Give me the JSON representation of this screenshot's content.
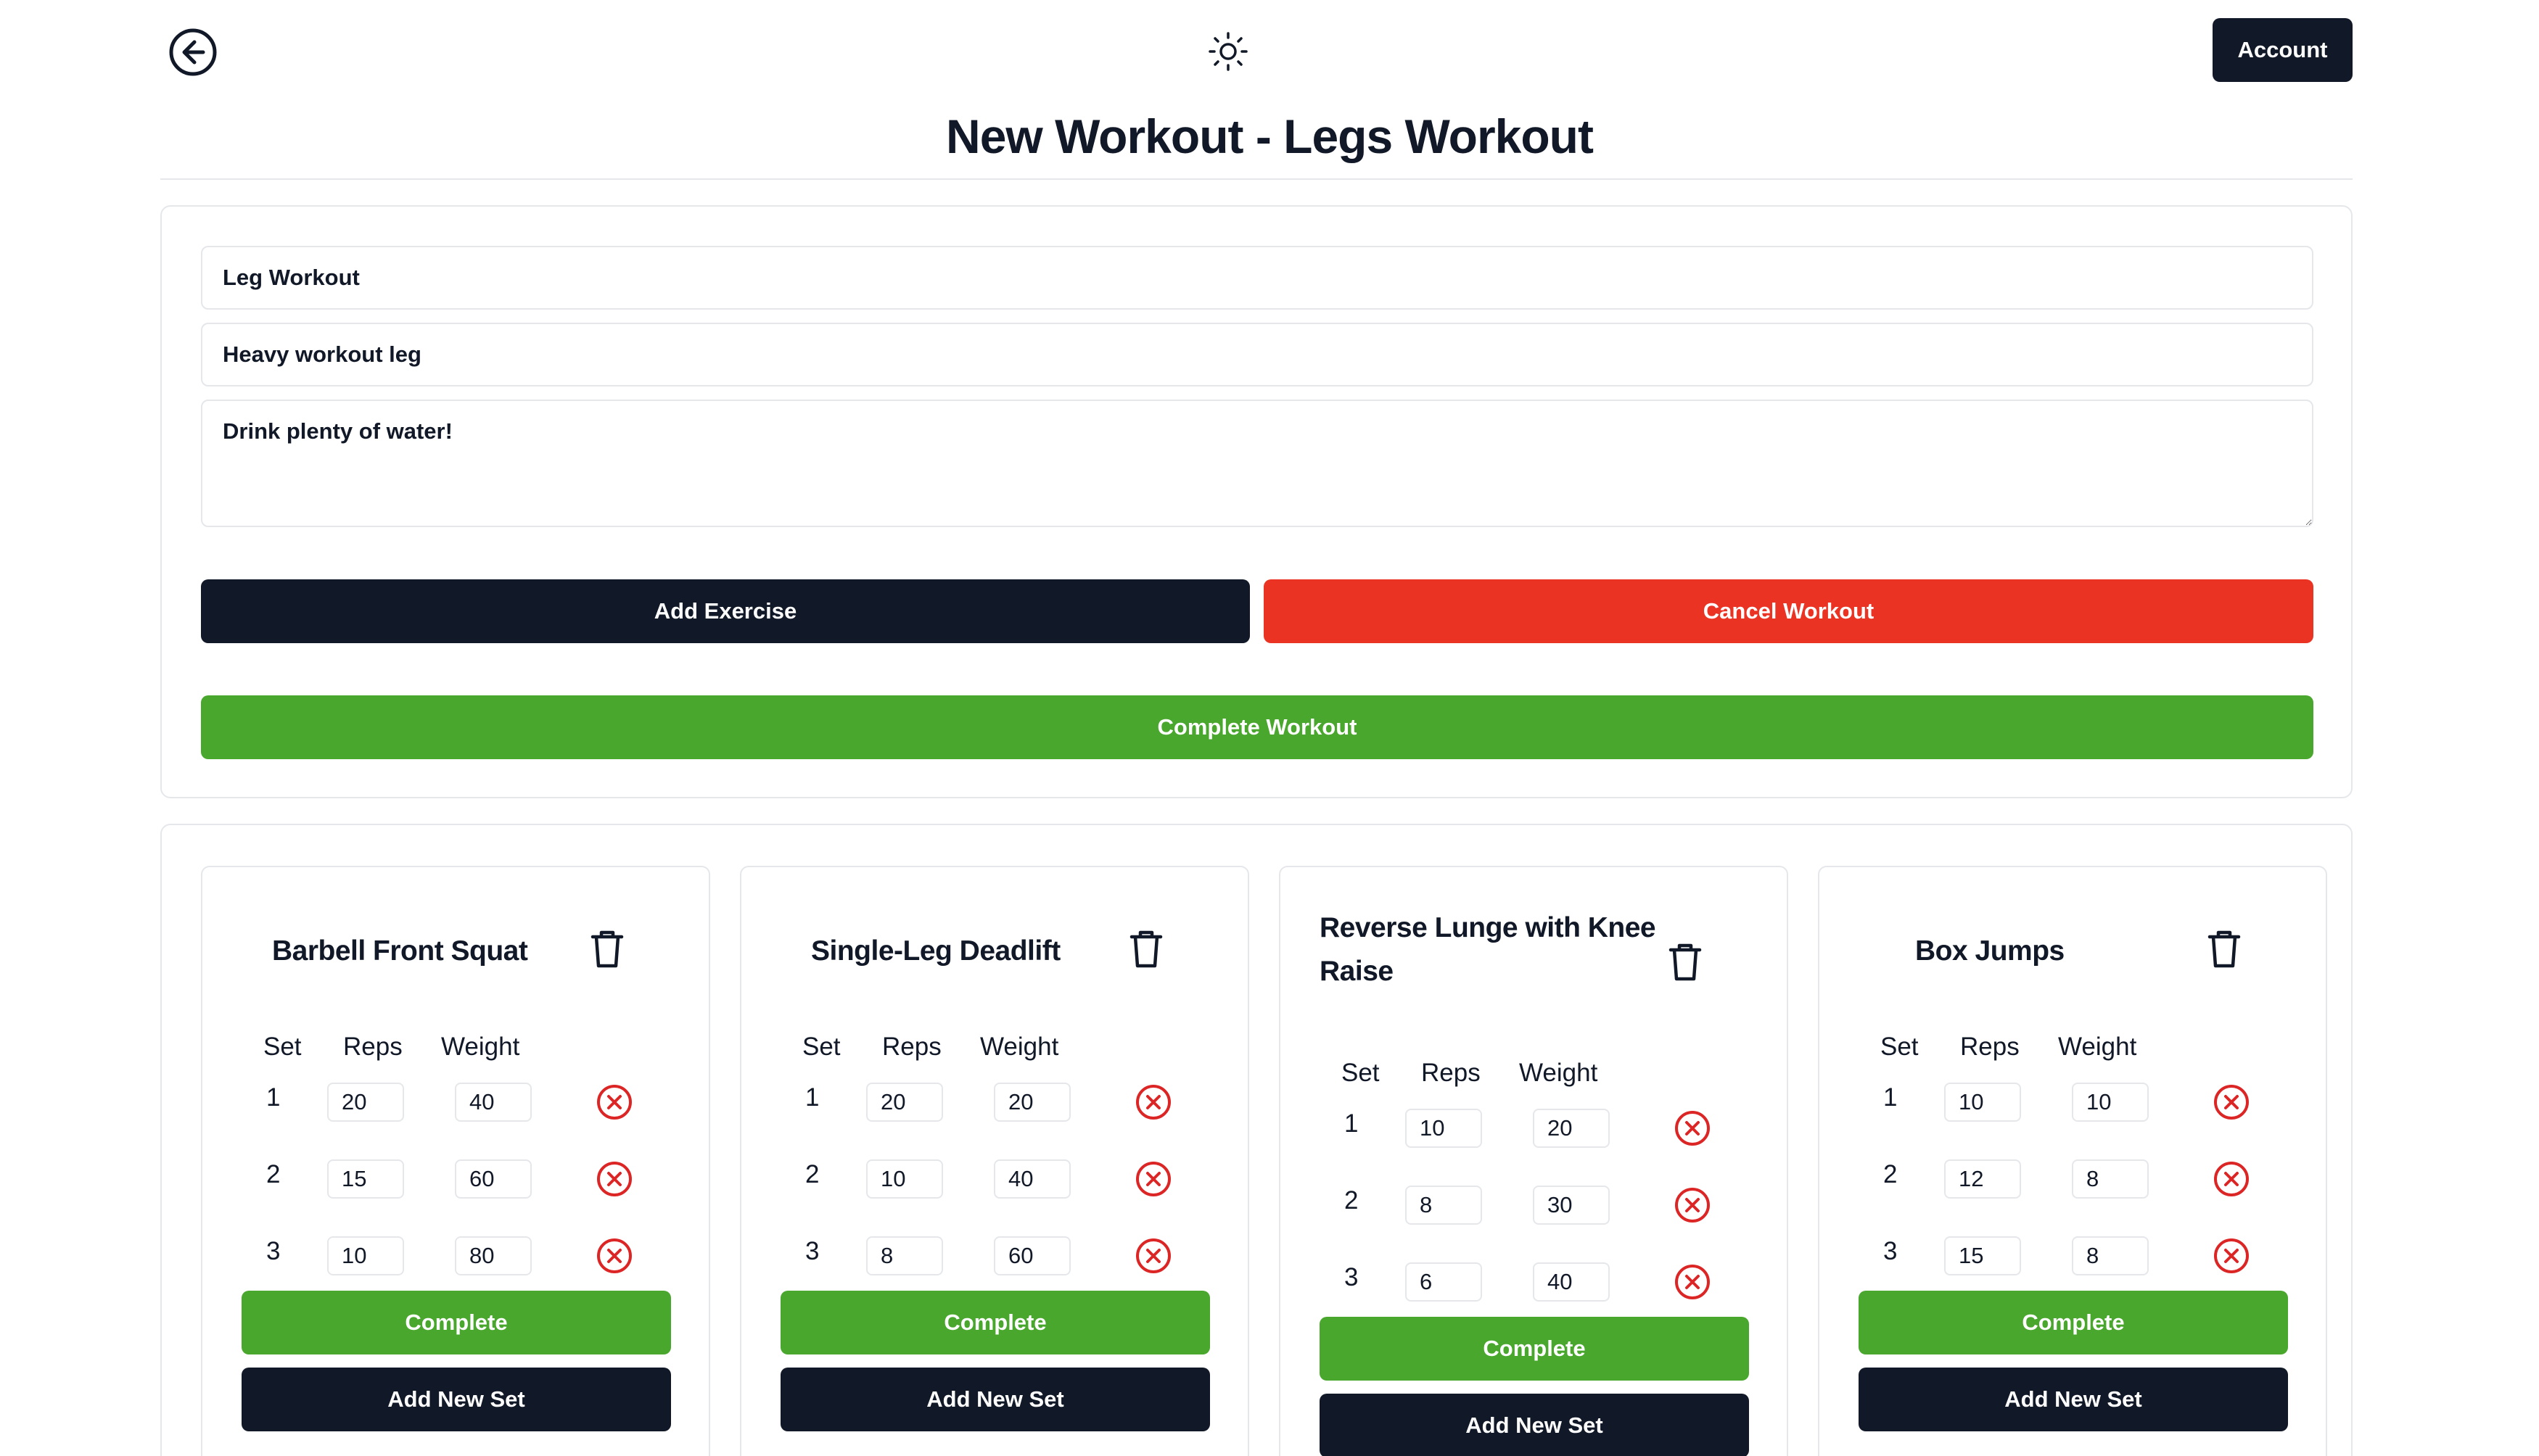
{
  "header": {
    "back_icon": "arrow-left-circle-icon",
    "theme_icon": "sun-icon",
    "account_label": "Account",
    "title": "New Workout - Legs Workout"
  },
  "form": {
    "name_value": "Leg Workout",
    "description_value": "Heavy workout leg",
    "notes_value": "Drink plenty of water!",
    "add_exercise_label": "Add Exercise",
    "cancel_workout_label": "Cancel Workout",
    "complete_workout_label": "Complete Workout"
  },
  "colors": {
    "primary": "#111827",
    "danger": "#ea3323",
    "success": "#4aa72d",
    "remove_icon": "#dc2626"
  },
  "exercises": [
    {
      "name": "Barbell Front Squat",
      "columns": {
        "set": "Set",
        "reps": "Reps",
        "weight": "Weight"
      },
      "sets": [
        {
          "set": "1",
          "reps": "20",
          "weight": "40"
        },
        {
          "set": "2",
          "reps": "15",
          "weight": "60"
        },
        {
          "set": "3",
          "reps": "10",
          "weight": "80"
        }
      ],
      "complete_label": "Complete",
      "add_set_label": "Add New Set"
    },
    {
      "name": "Single-Leg Deadlift",
      "columns": {
        "set": "Set",
        "reps": "Reps",
        "weight": "Weight"
      },
      "sets": [
        {
          "set": "1",
          "reps": "20",
          "weight": "20"
        },
        {
          "set": "2",
          "reps": "10",
          "weight": "40"
        },
        {
          "set": "3",
          "reps": "8",
          "weight": "60"
        }
      ],
      "complete_label": "Complete",
      "add_set_label": "Add New Set"
    },
    {
      "name_line1": "Reverse Lunge with Knee",
      "name_line2": "Raise",
      "columns": {
        "set": "Set",
        "reps": "Reps",
        "weight": "Weight"
      },
      "sets": [
        {
          "set": "1",
          "reps": "10",
          "weight": "20"
        },
        {
          "set": "2",
          "reps": "8",
          "weight": "30"
        },
        {
          "set": "3",
          "reps": "6",
          "weight": "40"
        }
      ],
      "complete_label": "Complete",
      "add_set_label": "Add New Set"
    },
    {
      "name": "Box Jumps",
      "columns": {
        "set": "Set",
        "reps": "Reps",
        "weight": "Weight"
      },
      "sets": [
        {
          "set": "1",
          "reps": "10",
          "weight": "10"
        },
        {
          "set": "2",
          "reps": "12",
          "weight": "8"
        },
        {
          "set": "3",
          "reps": "15",
          "weight": "8"
        }
      ],
      "complete_label": "Complete",
      "add_set_label": "Add New Set"
    }
  ]
}
